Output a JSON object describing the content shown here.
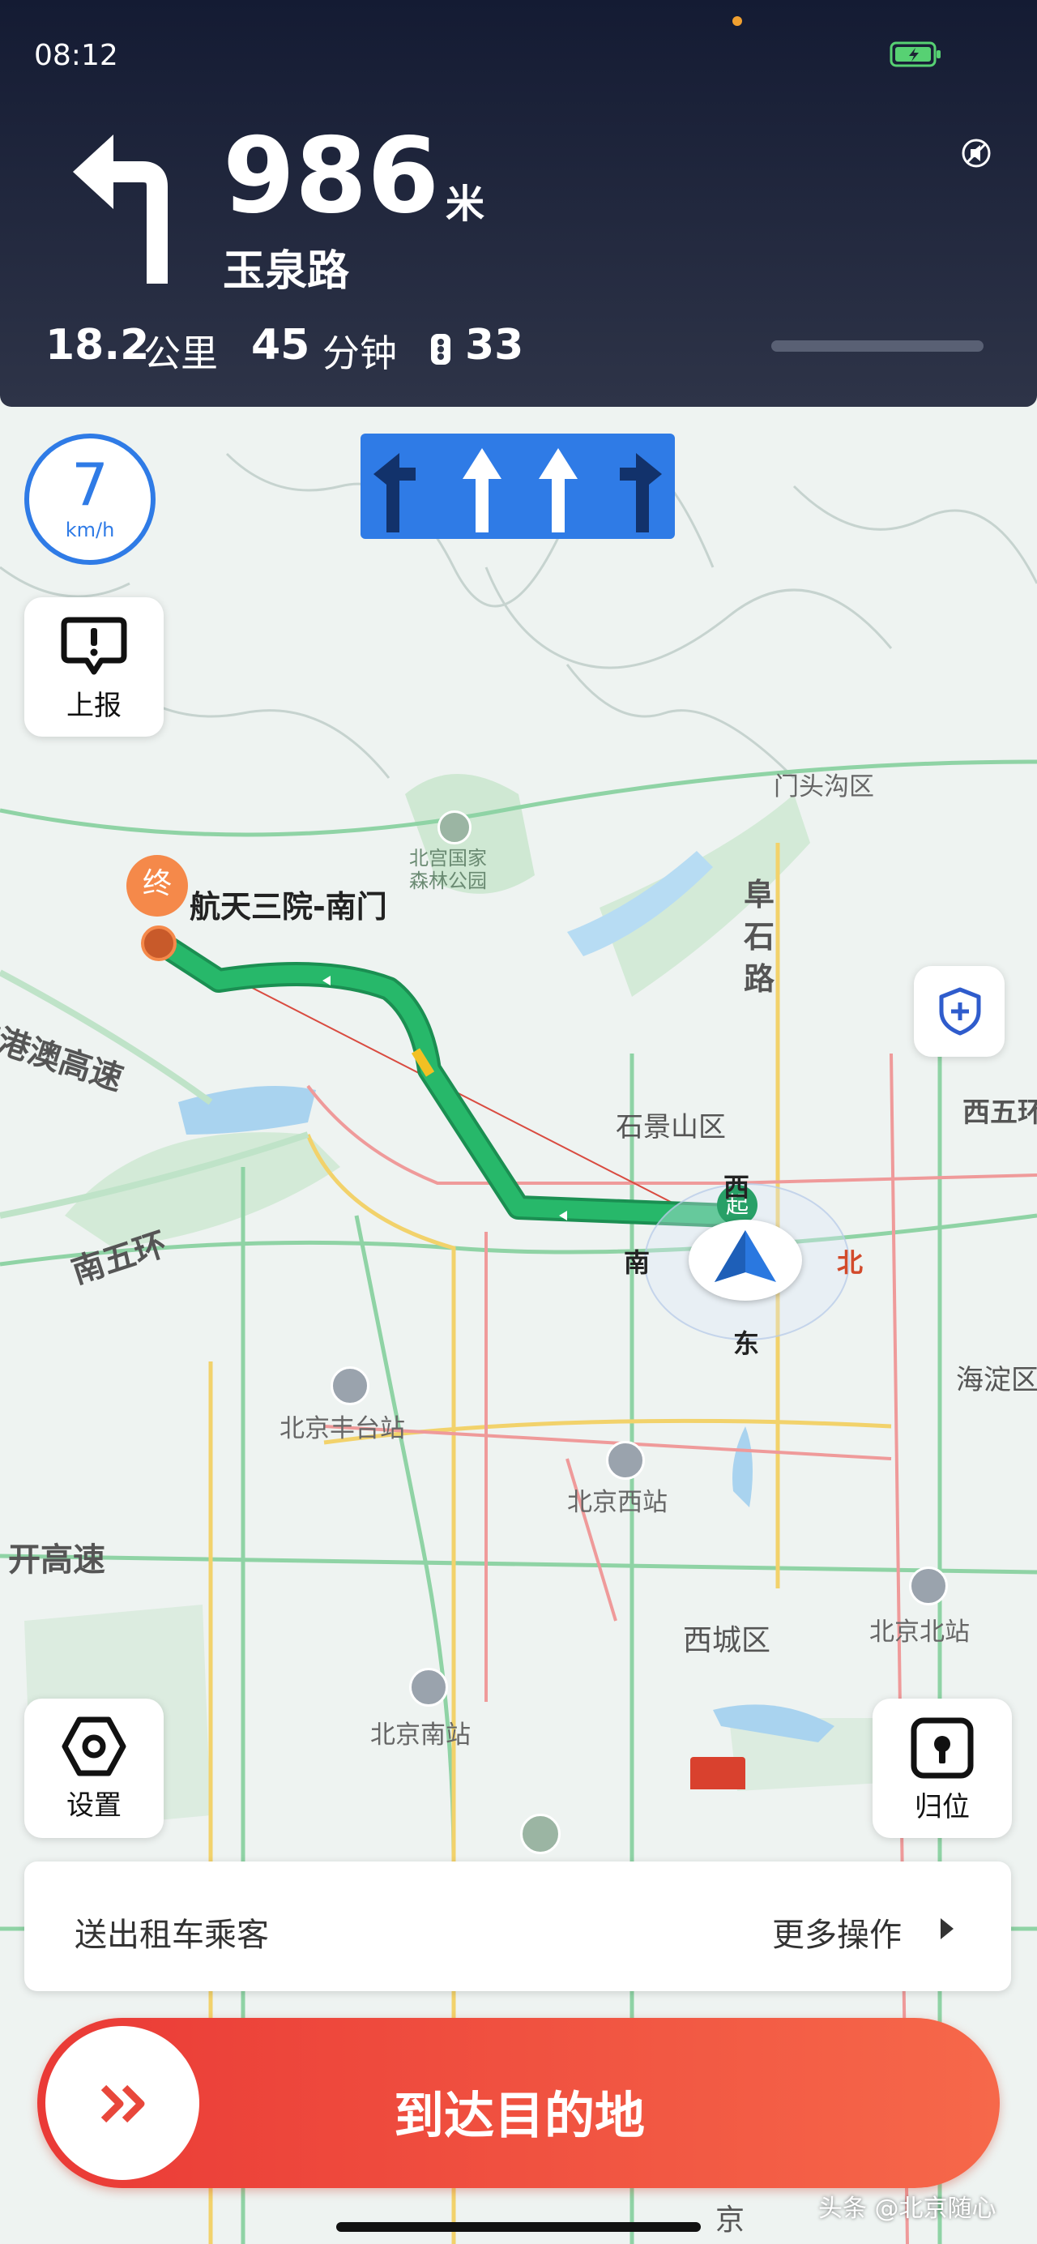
{
  "status_bar": {
    "time": "08:12"
  },
  "nav": {
    "distance": "986",
    "distance_unit": "米",
    "road": "玉泉路",
    "remaining_distance": "18.2",
    "remaining_distance_unit": "公里",
    "remaining_time": "45",
    "remaining_time_unit": "分钟",
    "traffic_lights": "33"
  },
  "speed": {
    "value": "7",
    "unit": "km/h"
  },
  "buttons": {
    "report": "上报",
    "settings": "设置",
    "recenter": "归位"
  },
  "destination": {
    "badge": "终",
    "name": "航天三院-南门"
  },
  "compass": {
    "north": "北",
    "south": "南",
    "east": "东",
    "west": "西",
    "start": "起"
  },
  "map_labels": {
    "mentougou": "门头沟区",
    "park": "北宫国家\n森林公园",
    "fushi_road": "阜\n石\n路",
    "jinggangao": "京港澳高速",
    "shijingshan": "石景山区",
    "xiwuhuan": "西五环",
    "nanwuhuan": "南五环",
    "haidian": "海淀区",
    "fengtai_station": "北京丰台站",
    "west_station": "北京西站",
    "xicheng": "西城区",
    "north_station": "北京北站",
    "south_station": "北京南站",
    "kai_highway": "开高速",
    "partial_jing": "京"
  },
  "actions": {
    "drop_off": "送出租车乘客",
    "more": "更多操作"
  },
  "arrive_button": "到达目的地",
  "watermark": "头条 @北京随心",
  "colors": {
    "route": "#27b86a",
    "arrive": "#f0473c",
    "lane_panel": "#2f7be6",
    "header": "#1c2238"
  }
}
